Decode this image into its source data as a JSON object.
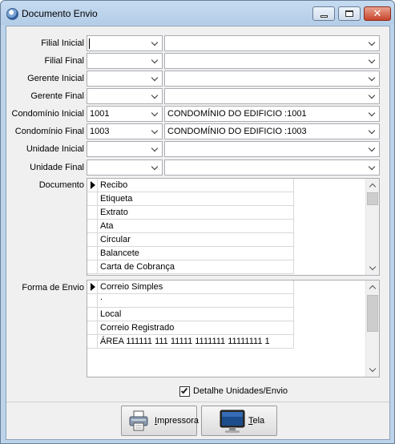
{
  "window": {
    "title": "Documento Envio"
  },
  "form": {
    "filial_inicial": {
      "label": "Filial Inicial",
      "code": "",
      "name": ""
    },
    "filial_final": {
      "label": "Filial Final",
      "code": "",
      "name": ""
    },
    "gerente_inicial": {
      "label": "Gerente Inicial",
      "code": "",
      "name": ""
    },
    "gerente_final": {
      "label": "Gerente Final",
      "code": "",
      "name": ""
    },
    "condominio_inicial": {
      "label": "Condomínio Inicial",
      "code": "1001",
      "name": "CONDOMÍNIO DO EDIFICIO :1001"
    },
    "condominio_final": {
      "label": "Condomínio Final",
      "code": "1003",
      "name": "CONDOMÍNIO DO EDIFICIO :1003"
    },
    "unidade_inicial": {
      "label": "Unidade Inicial",
      "code": "",
      "name": ""
    },
    "unidade_final": {
      "label": "Unidade Final",
      "code": "",
      "name": ""
    }
  },
  "documento": {
    "label": "Documento",
    "items": [
      "Recibo",
      "Etiqueta",
      "Extrato",
      "Ata",
      "Circular",
      "Balancete",
      "Carta de Cobrança"
    ]
  },
  "forma_envio": {
    "label": "Forma de Envio",
    "items": [
      "Correio Simples",
      ".",
      "Local",
      "Correio Registrado",
      "ÁREA 111111 111 11111 1111111 11111111 1"
    ]
  },
  "detalhe": {
    "label": "Detalhe Unidades/Envio",
    "checked": true
  },
  "buttons": {
    "impressora_prefix": "I",
    "impressora_rest": "mpressora",
    "tela_prefix": "T",
    "tela_rest": "ela"
  }
}
